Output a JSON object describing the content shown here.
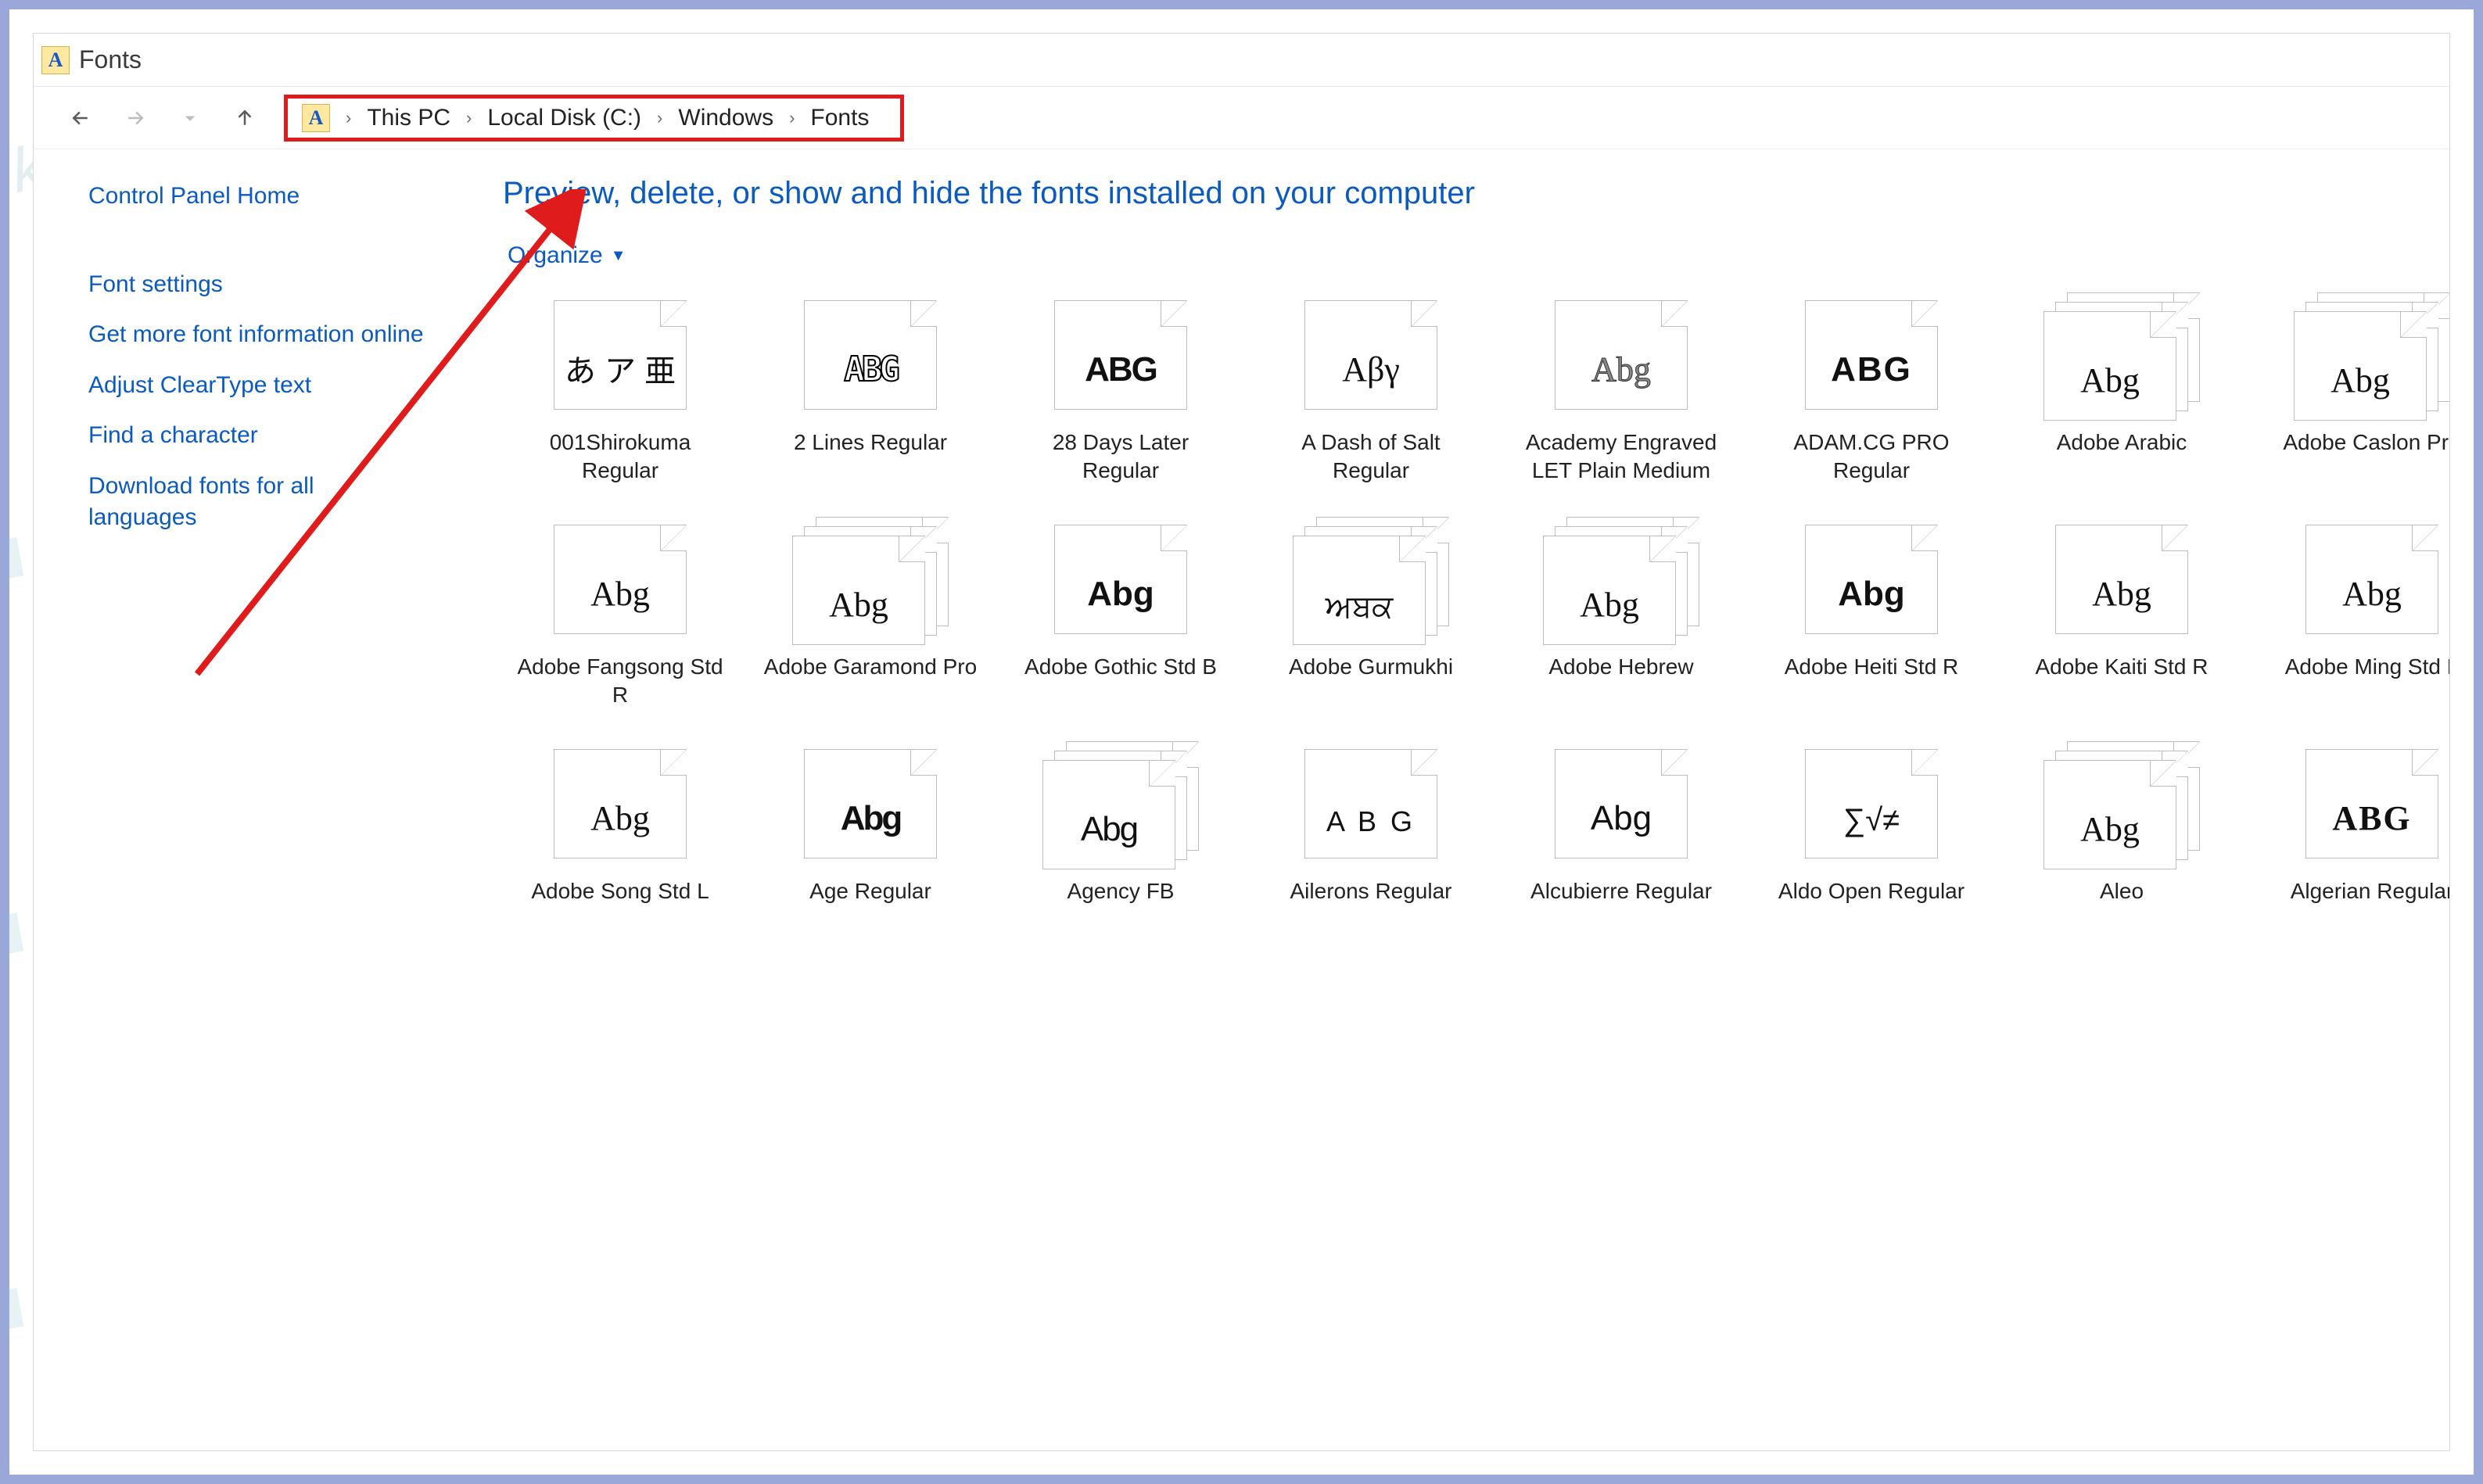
{
  "titlebar": {
    "icon_letter": "A",
    "title": "Fonts"
  },
  "nav": {
    "back_enabled": true,
    "forward_enabled": false,
    "up_enabled": true
  },
  "breadcrumbs": {
    "icon_letter": "A",
    "items": [
      "This PC",
      "Local Disk (C:)",
      "Windows",
      "Fonts"
    ]
  },
  "sidebar": {
    "links": [
      "Control Panel Home",
      "Font settings",
      "Get more font information online",
      "Adjust ClearType text",
      "Find a character",
      "Download fonts for all languages"
    ]
  },
  "main": {
    "title": "Preview, delete, or show and hide the fonts installed on your computer",
    "organize": "Organize"
  },
  "fonts": [
    {
      "name": "001Shirokuma Regular",
      "sample": "あ ア 亜",
      "stack": false,
      "style": "font-size:40px;"
    },
    {
      "name": "2 Lines Regular",
      "sample": "ABG",
      "stack": false,
      "style": "font-family:monospace;letter-spacing:-4px;text-shadow:0 0 0 #000,2px 0 0 #fff,-2px 0 0 #fff,0 2px 0 #fff,0 -2px 0 #fff;-webkit-text-stroke:2px #000;color:#fff;font-weight:700;"
    },
    {
      "name": "28 Days Later Regular",
      "sample": "ABG",
      "stack": false,
      "style": "font-weight:900;letter-spacing:-2px;"
    },
    {
      "name": "A Dash of Salt Regular",
      "sample": "Αβγ",
      "stack": false,
      "style": "font-family:Georgia,serif;"
    },
    {
      "name": "Academy Engraved LET Plain Medium",
      "sample": "Abg",
      "stack": false,
      "style": "font-family:Georgia,serif;color:#888;-webkit-text-stroke:1px #333;"
    },
    {
      "name": "ADAM.CG PRO Regular",
      "sample": "ABG",
      "stack": false,
      "style": "font-weight:700;letter-spacing:2px;"
    },
    {
      "name": "Adobe Arabic",
      "sample": "Abg",
      "stack": true,
      "style": "font-family:Georgia,serif;"
    },
    {
      "name": "Adobe Caslon Pro",
      "sample": "Abg",
      "stack": true,
      "style": "font-family:Georgia,serif;"
    },
    {
      "name": "Adobe Fangsong Std R",
      "sample": "Abg",
      "stack": false,
      "style": "font-family:Georgia,serif;"
    },
    {
      "name": "Adobe Garamond Pro",
      "sample": "Abg",
      "stack": true,
      "style": "font-family:Georgia,serif;"
    },
    {
      "name": "Adobe Gothic Std B",
      "sample": "Abg",
      "stack": false,
      "style": "font-weight:800;"
    },
    {
      "name": "Adobe Gurmukhi",
      "sample": "ਅਬਕ",
      "stack": true,
      "style": "font-size:40px;"
    },
    {
      "name": "Adobe Hebrew",
      "sample": "Abg",
      "stack": true,
      "style": "font-family:Georgia,serif;"
    },
    {
      "name": "Adobe Heiti Std R",
      "sample": "Abg",
      "stack": false,
      "style": "font-weight:700;"
    },
    {
      "name": "Adobe Kaiti Std R",
      "sample": "Abg",
      "stack": false,
      "style": "font-family:Georgia,serif;"
    },
    {
      "name": "Adobe Ming Std L",
      "sample": "Abg",
      "stack": false,
      "style": "font-family:Georgia,serif;font-weight:300;"
    },
    {
      "name": "Adobe Song Std L",
      "sample": "Abg",
      "stack": false,
      "style": "font-family:Georgia,serif;font-weight:300;"
    },
    {
      "name": "Age Regular",
      "sample": "Abg",
      "stack": false,
      "style": "font-weight:900;letter-spacing:-3px;"
    },
    {
      "name": "Agency FB",
      "sample": "Abg",
      "stack": true,
      "style": "font-stretch:condensed;letter-spacing:-2px;"
    },
    {
      "name": "Ailerons Regular",
      "sample": "A B G",
      "stack": false,
      "style": "font-weight:300;letter-spacing:4px;font-size:36px;"
    },
    {
      "name": "Alcubierre Regular",
      "sample": "Abg",
      "stack": false,
      "style": "font-weight:300;"
    },
    {
      "name": "Aldo Open Regular",
      "sample": "∑√≠",
      "stack": false,
      "style": "font-size:40px;"
    },
    {
      "name": "Aleo",
      "sample": "Abg",
      "stack": true,
      "style": "font-family:Georgia,serif;"
    },
    {
      "name": "Algerian Regular",
      "sample": "ABG",
      "stack": false,
      "style": "font-family:Georgia,serif;font-weight:700;letter-spacing:2px;"
    }
  ],
  "watermark": "kompiwin"
}
